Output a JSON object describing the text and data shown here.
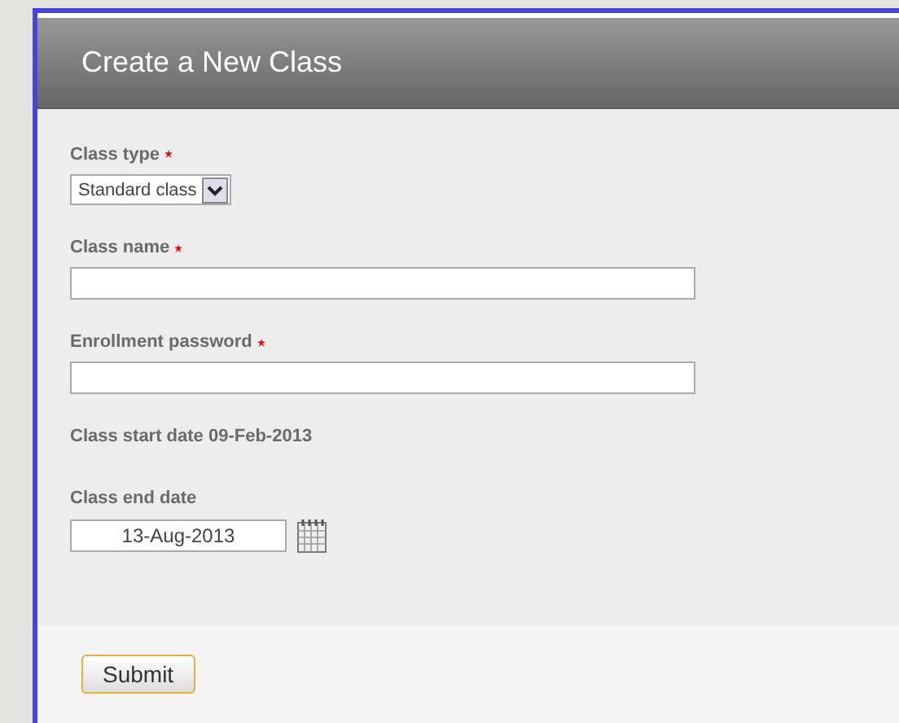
{
  "header": {
    "title": "Create a New Class"
  },
  "fields": [
    {
      "kind": "select",
      "label": "Class type",
      "required": true,
      "value": "Standard class"
    },
    {
      "kind": "text",
      "label": "Class name",
      "required": true
    },
    {
      "kind": "text",
      "label": "Enrollment password",
      "required": true
    },
    {
      "kind": "info",
      "label": "Class start date 09-Feb-2013"
    },
    {
      "kind": "date",
      "label": "Class end date",
      "required": false,
      "value": "13-Aug-2013"
    }
  ],
  "buttons": [
    "Submit"
  ]
}
